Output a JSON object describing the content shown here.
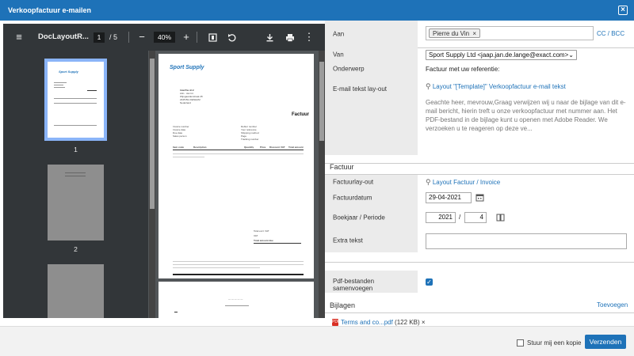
{
  "window": {
    "title": "Verkoopfactuur e-mailen",
    "close_icon": "close-icon"
  },
  "viewer": {
    "doc_title": "DocLayoutR...",
    "current_page": "1",
    "total_pages": "/ 5",
    "zoom": "40%",
    "thumb_labels": [
      "1",
      "2"
    ],
    "invoice": {
      "brand": "Sport Supply",
      "heading": "Factuur",
      "addr": [
        "InterPas B.V.",
        "Attn.: Jan Int",
        "Wijngaardenstraat 28",
        "2345 BG  DENHAM",
        "Nederland"
      ],
      "meta_left": [
        "Invoice number",
        "Invoice date",
        "Due date",
        "Sales person"
      ],
      "meta_right": [
        "Debtor number",
        "Your reference",
        "Shipping method",
        "Page",
        "Tracking number"
      ],
      "cols": [
        "Item code",
        "Description",
        "Quantity",
        "Price",
        "Discount",
        "VAT",
        "Total amount"
      ],
      "totals": [
        "Total excl. VAT",
        "VAT",
        "Total amount due"
      ],
      "page2_line": "— — — — —"
    }
  },
  "form": {
    "aan_label": "Aan",
    "recipient": "Pierre du Vin",
    "cc_bcc": "CC / BCC",
    "van_label": "Van",
    "van_value": "Sport Supply Ltd <jaap.jan.de.lange@exact.com>",
    "onderwerp_label": "Onderwerp",
    "onderwerp_value": "Factuur met uw referentie:",
    "email_layout_label": "E-mail tekst lay-out",
    "email_layout_link": "Layout \"[Template]\" Verkoopfactuur e-mail tekst",
    "email_body": "Geachte heer, mevrouw,Graag verwijzen wij u naar de bijlage van dit e-mail bericht, hierin treft u onze verkoopfactuur met nummer  aan. Het PDF-bestand in de bijlage kunt u openen met Adobe Reader. We verzoeken u te reageren op deze ve...",
    "factuur_section": "Factuur",
    "factuurlayout_label": "Factuurlay-out",
    "factuurlayout_link": "Layout Factuur / Invoice",
    "factuurdatum_label": "Factuurdatum",
    "factuurdatum_value": "29-04-2021",
    "boekjaar_label": "Boekjaar / Periode",
    "boekjaar_value": "2021",
    "periode_sep": "/",
    "periode_value": "4",
    "extra_label": "Extra tekst",
    "pdf_label_1": "Pdf-bestanden",
    "pdf_label_2": "samenvoegen",
    "bijlagen_section": "Bijlagen",
    "toevoegen": "Toevoegen",
    "attachment_name": "Terms and co...pdf",
    "attachment_size": "(122 KB)",
    "pdf_icon_text": "PDF"
  },
  "footer": {
    "copy_label": "Stuur mij een kopie",
    "send_label": "Verzenden"
  },
  "colors": {
    "accent": "#1e72b8",
    "viewer_bg": "#525659",
    "toolbar_bg": "#323639",
    "label_bg": "#ebebeb"
  }
}
